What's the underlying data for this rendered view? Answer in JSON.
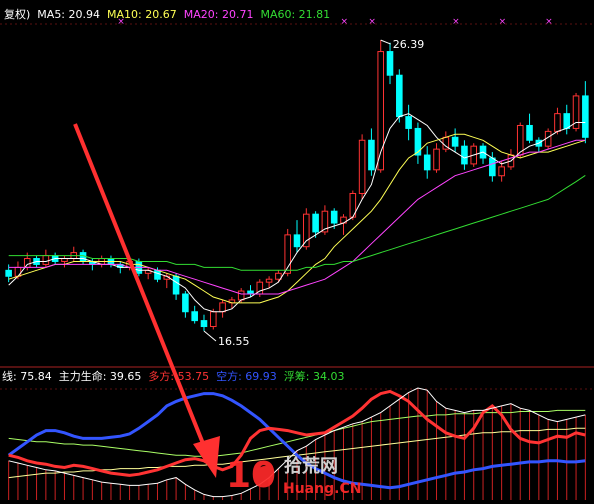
{
  "price_panel": {
    "legend": [
      {
        "text": "复权)",
        "color": "#ffffff"
      },
      {
        "text": "MA5: 20.94",
        "color": "#ffffff"
      },
      {
        "text": "MA10: 20.67",
        "color": "#ffff55"
      },
      {
        "text": "MA20: 20.71",
        "color": "#ff44ff"
      },
      {
        "text": "MA60: 21.81",
        "color": "#33dd33"
      }
    ],
    "high_label": "26.39",
    "low_label": "16.55"
  },
  "indicator_panel": {
    "legend": [
      {
        "text": "线: 75.84",
        "color": "#ffffff"
      },
      {
        "text": "主力生命: 39.65",
        "color": "#ffffff"
      },
      {
        "text": "多方: 53.75",
        "color": "#ff3333"
      },
      {
        "text": "空方: 69.93",
        "color": "#3355ff"
      },
      {
        "text": "浮筹: 34.03",
        "color": "#33dd33"
      }
    ]
  },
  "watermark": {
    "number": "10",
    "chinese": "拾荒网",
    "latin": "Huang.CN"
  },
  "colors": {
    "up": "#ff3333",
    "down": "#00ffff",
    "ma5": "#ffffff",
    "ma10": "#ffff55",
    "ma20": "#ff44ff",
    "ma60": "#33dd33",
    "arrow": "#ff3030"
  },
  "chart_data": {
    "type": "candlestick",
    "price_ylim": [
      15.5,
      27.0
    ],
    "candles": [
      [
        18.6,
        18.8,
        18.2,
        18.4
      ],
      [
        18.4,
        18.9,
        18.3,
        18.7
      ],
      [
        18.7,
        19.2,
        18.6,
        19.0
      ],
      [
        19.0,
        19.1,
        18.7,
        18.8
      ],
      [
        18.8,
        19.3,
        18.7,
        19.1
      ],
      [
        19.1,
        19.2,
        18.8,
        18.9
      ],
      [
        18.9,
        19.1,
        18.7,
        19.0
      ],
      [
        19.0,
        19.4,
        18.9,
        19.2
      ],
      [
        19.2,
        19.3,
        18.8,
        18.9
      ],
      [
        18.9,
        19.0,
        18.6,
        18.8
      ],
      [
        18.8,
        19.1,
        18.7,
        19.0
      ],
      [
        19.0,
        19.1,
        18.7,
        18.8
      ],
      [
        18.8,
        18.9,
        18.5,
        18.7
      ],
      [
        18.7,
        19.0,
        18.6,
        18.9
      ],
      [
        18.9,
        19.0,
        18.4,
        18.5
      ],
      [
        18.5,
        18.7,
        18.3,
        18.6
      ],
      [
        18.6,
        18.7,
        18.2,
        18.3
      ],
      [
        18.3,
        18.5,
        18.0,
        18.4
      ],
      [
        18.4,
        18.5,
        17.6,
        17.8
      ],
      [
        17.8,
        17.9,
        17.0,
        17.2
      ],
      [
        17.2,
        17.4,
        16.8,
        16.9
      ],
      [
        16.9,
        17.1,
        16.55,
        16.7
      ],
      [
        16.7,
        17.3,
        16.6,
        17.2
      ],
      [
        17.2,
        17.6,
        17.0,
        17.5
      ],
      [
        17.5,
        17.7,
        17.3,
        17.6
      ],
      [
        17.6,
        18.0,
        17.5,
        17.9
      ],
      [
        17.9,
        18.1,
        17.7,
        17.8
      ],
      [
        17.8,
        18.3,
        17.7,
        18.2
      ],
      [
        18.2,
        18.4,
        18.0,
        18.3
      ],
      [
        18.3,
        18.6,
        18.2,
        18.5
      ],
      [
        18.5,
        20.0,
        18.4,
        19.8
      ],
      [
        19.8,
        20.3,
        19.2,
        19.4
      ],
      [
        19.4,
        20.7,
        19.3,
        20.5
      ],
      [
        20.5,
        20.6,
        19.7,
        19.9
      ],
      [
        19.9,
        20.8,
        19.8,
        20.6
      ],
      [
        20.6,
        20.7,
        20.0,
        20.2
      ],
      [
        20.2,
        20.5,
        19.8,
        20.4
      ],
      [
        20.4,
        21.3,
        20.3,
        21.2
      ],
      [
        21.2,
        23.2,
        21.0,
        23.0
      ],
      [
        23.0,
        23.4,
        21.8,
        22.0
      ],
      [
        22.0,
        26.39,
        21.9,
        26.0
      ],
      [
        26.0,
        26.3,
        24.9,
        25.2
      ],
      [
        25.2,
        25.4,
        23.6,
        23.8
      ],
      [
        23.8,
        24.2,
        23.0,
        23.4
      ],
      [
        23.4,
        23.6,
        22.2,
        22.5
      ],
      [
        22.5,
        22.8,
        21.7,
        22.0
      ],
      [
        22.0,
        22.9,
        21.9,
        22.7
      ],
      [
        22.7,
        23.3,
        22.6,
        23.1
      ],
      [
        23.1,
        23.4,
        22.6,
        22.8
      ],
      [
        22.8,
        23.0,
        22.0,
        22.2
      ],
      [
        22.2,
        22.9,
        22.1,
        22.8
      ],
      [
        22.8,
        22.9,
        22.2,
        22.4
      ],
      [
        22.4,
        22.6,
        21.6,
        21.8
      ],
      [
        21.8,
        22.3,
        21.6,
        22.1
      ],
      [
        22.1,
        22.7,
        22.0,
        22.5
      ],
      [
        22.5,
        23.6,
        22.4,
        23.5
      ],
      [
        23.5,
        23.9,
        22.9,
        23.0
      ],
      [
        23.0,
        23.1,
        22.6,
        22.8
      ],
      [
        22.8,
        23.4,
        22.7,
        23.3
      ],
      [
        23.3,
        24.1,
        23.2,
        23.9
      ],
      [
        23.9,
        24.2,
        23.2,
        23.4
      ],
      [
        23.4,
        24.6,
        23.3,
        24.5
      ],
      [
        24.5,
        25.0,
        22.9,
        23.1
      ]
    ],
    "moving_averages": {
      "MA5": [
        18.1,
        18.4,
        18.8,
        18.9,
        18.9,
        19.0,
        19.0,
        19.0,
        19.0,
        18.9,
        18.8,
        18.8,
        18.7,
        18.7,
        18.6,
        18.6,
        18.5,
        18.4,
        18.2,
        18.0,
        17.6,
        17.3,
        17.2,
        17.2,
        17.3,
        17.6,
        17.7,
        17.9,
        18.0,
        18.2,
        18.7,
        19.2,
        19.6,
        19.8,
        20.0,
        20.1,
        20.2,
        20.4,
        21.0,
        21.5,
        22.6,
        23.4,
        23.8,
        23.9,
        23.7,
        23.5,
        23.1,
        22.8,
        22.6,
        22.4,
        22.5,
        22.6,
        22.4,
        22.2,
        22.3,
        22.6,
        22.8,
        22.9,
        23.1,
        23.3,
        23.4,
        23.6,
        23.6
      ],
      "MA10": [
        18.3,
        18.4,
        18.5,
        18.6,
        18.7,
        18.8,
        18.8,
        18.9,
        18.9,
        18.9,
        18.9,
        18.9,
        18.9,
        18.8,
        18.8,
        18.7,
        18.6,
        18.5,
        18.4,
        18.3,
        18.1,
        17.9,
        17.7,
        17.6,
        17.5,
        17.5,
        17.5,
        17.5,
        17.6,
        17.7,
        17.9,
        18.2,
        18.5,
        18.8,
        19.0,
        19.4,
        19.7,
        20.0,
        20.3,
        20.6,
        21.0,
        21.5,
        22.0,
        22.4,
        22.6,
        22.9,
        23.0,
        23.1,
        23.2,
        23.2,
        23.1,
        23.0,
        22.8,
        22.6,
        22.5,
        22.4,
        22.5,
        22.6,
        22.6,
        22.7,
        22.8,
        22.9,
        23.0
      ],
      "MA20": [
        18.7,
        18.7,
        18.7,
        18.7,
        18.7,
        18.8,
        18.8,
        18.8,
        18.8,
        18.8,
        18.8,
        18.8,
        18.8,
        18.7,
        18.7,
        18.7,
        18.6,
        18.6,
        18.5,
        18.4,
        18.3,
        18.2,
        18.1,
        18.0,
        17.9,
        17.8,
        17.8,
        17.8,
        17.8,
        17.8,
        17.9,
        18.0,
        18.1,
        18.2,
        18.3,
        18.5,
        18.7,
        18.9,
        19.2,
        19.5,
        19.8,
        20.1,
        20.4,
        20.7,
        21.0,
        21.2,
        21.4,
        21.6,
        21.8,
        21.9,
        22.0,
        22.1,
        22.2,
        22.3,
        22.4,
        22.5,
        22.6,
        22.6,
        22.7,
        22.8,
        22.9,
        23.0,
        23.0
      ],
      "MA60": [
        19.1,
        19.1,
        19.1,
        19.1,
        19.1,
        19.1,
        19.1,
        19.1,
        19.1,
        19.0,
        19.0,
        19.0,
        19.0,
        19.0,
        18.9,
        18.9,
        18.9,
        18.9,
        18.8,
        18.8,
        18.8,
        18.7,
        18.7,
        18.7,
        18.7,
        18.6,
        18.6,
        18.6,
        18.6,
        18.6,
        18.6,
        18.6,
        18.7,
        18.7,
        18.8,
        18.8,
        18.9,
        18.9,
        19.0,
        19.1,
        19.2,
        19.3,
        19.4,
        19.5,
        19.6,
        19.7,
        19.8,
        19.9,
        20.0,
        20.1,
        20.2,
        20.3,
        20.4,
        20.5,
        20.6,
        20.7,
        20.8,
        20.9,
        21.0,
        21.2,
        21.4,
        21.6,
        21.81
      ]
    },
    "indicator": {
      "ylim": [
        0,
        100
      ],
      "多方": [
        40,
        38,
        35,
        33,
        32,
        30,
        29,
        31,
        30,
        28,
        26,
        24,
        23,
        22,
        23,
        25,
        27,
        30,
        33,
        36,
        37,
        35,
        30,
        27,
        30,
        40,
        55,
        62,
        64,
        63,
        62,
        60,
        58,
        59,
        60,
        65,
        70,
        75,
        82,
        90,
        95,
        97,
        93,
        88,
        80,
        72,
        66,
        60,
        57,
        55,
        64,
        78,
        84,
        76,
        63,
        55,
        52,
        51,
        54,
        57,
        56,
        60,
        58
      ],
      "空方": [
        40,
        46,
        52,
        58,
        62,
        62,
        60,
        57,
        55,
        55,
        55,
        56,
        57,
        59,
        64,
        70,
        76,
        84,
        88,
        91,
        93,
        95,
        95,
        93,
        89,
        84,
        78,
        72,
        64,
        56,
        48,
        40,
        33,
        28,
        24,
        20,
        17,
        15,
        14,
        13,
        12,
        11,
        12,
        14,
        16,
        18,
        20,
        22,
        24,
        25,
        27,
        28,
        30,
        31,
        32,
        33,
        34,
        34,
        35,
        35,
        34,
        34,
        35
      ],
      "主力生命": [
        20,
        21,
        22,
        23,
        24,
        24,
        25,
        25,
        26,
        26,
        27,
        27,
        28,
        28,
        28,
        29,
        29,
        30,
        30,
        30,
        31,
        31,
        32,
        32,
        33,
        34,
        35,
        36,
        37,
        38,
        39,
        40,
        41,
        42,
        43,
        44,
        45,
        46,
        47,
        48,
        49,
        50,
        51,
        52,
        53,
        54,
        55,
        56,
        57,
        58,
        59,
        60,
        60,
        61,
        61,
        62,
        62,
        62,
        63,
        63,
        63,
        64,
        64
      ],
      "浮筹": [
        55,
        54,
        53,
        52,
        52,
        51,
        50,
        50,
        49,
        49,
        48,
        47,
        46,
        45,
        44,
        43,
        42,
        41,
        40,
        40,
        39,
        39,
        39,
        40,
        41,
        42,
        44,
        46,
        48,
        50,
        52,
        54,
        56,
        58,
        60,
        62,
        64,
        66,
        68,
        70,
        71,
        72,
        73,
        74,
        75,
        75,
        76,
        76,
        77,
        77,
        77,
        78,
        78,
        78,
        78,
        79,
        79,
        79,
        79,
        80,
        80,
        80,
        80
      ],
      "线": [
        35,
        33,
        31,
        29,
        27,
        26,
        24,
        22,
        20,
        18,
        16,
        15,
        14,
        13,
        13,
        14,
        15,
        18,
        20,
        14,
        9,
        5,
        3,
        3,
        4,
        6,
        10,
        14,
        20,
        28,
        36,
        44,
        48,
        54,
        58,
        62,
        65,
        68,
        70,
        74,
        78,
        84,
        90,
        96,
        100,
        98,
        88,
        82,
        80,
        78,
        80,
        80,
        82,
        84,
        86,
        82,
        80,
        76,
        72,
        70,
        72,
        74,
        76
      ]
    },
    "annotations": [
      "26.39",
      "16.55"
    ]
  }
}
